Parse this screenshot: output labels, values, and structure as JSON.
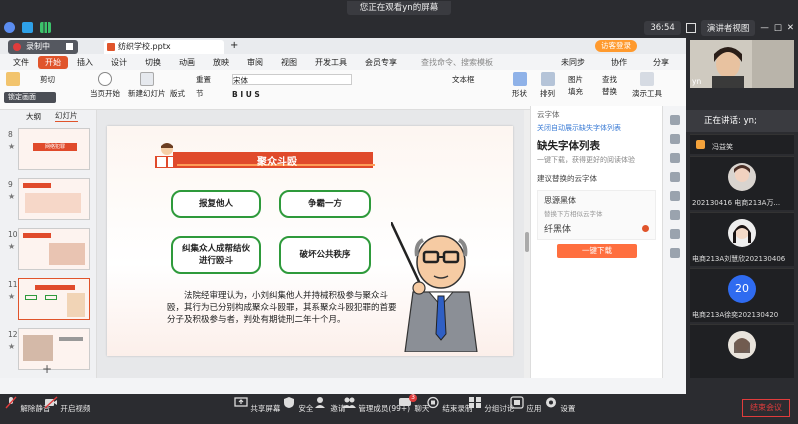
{
  "meeting": {
    "viewing_title": "您正在观看yn的屏幕",
    "time": "36:54",
    "view_mode": "演讲者视图",
    "recording_label": "录制中",
    "lock_screen": "锁定画面"
  },
  "wps": {
    "doc_tab": "纺织学校.pptx",
    "login_btn": "访客登录",
    "menu": [
      "文件",
      "开始",
      "插入",
      "设计",
      "切换",
      "动画",
      "放映",
      "审阅",
      "视图",
      "开发工具",
      "会员专享"
    ],
    "search": "查找命令、搜索模板",
    "menu_right": [
      "未同步",
      "协作",
      "分享"
    ],
    "ribbon": {
      "paste": "粘贴",
      "copy": "复制",
      "format": "格式刷",
      "cut": "剪切",
      "from_current": "当页开始",
      "new_slide": "新建幻灯片",
      "layout": "版式",
      "section": "节",
      "reset": "重置",
      "text_box": "文本框",
      "shape": "形状",
      "arrange": "排列",
      "picture": "图片",
      "fill": "填充",
      "find": "查找",
      "replace": "替换",
      "select": "选择",
      "textbox2": "文本框",
      "toolbox": "演示工具",
      "fonts": "宋体"
    },
    "thumb_tabs": [
      "大纲",
      "幻灯片"
    ],
    "slides": [
      {
        "num": "8",
        "caption": "网络犯罪"
      },
      {
        "num": "9",
        "caption": ""
      },
      {
        "num": "10",
        "caption": ""
      },
      {
        "num": "11",
        "caption": ""
      },
      {
        "num": "12",
        "caption": ""
      }
    ],
    "star": "★"
  },
  "slide": {
    "title": "聚众斗殴",
    "boxes": [
      "报复他人",
      "争霸一方",
      "纠集众人成帮结伙进行殴斗",
      "破坏公共秩序"
    ],
    "body": "法院经审理认为，小刘纠集他人并持械积极参与聚众斗殴，其行为已分别构成聚众斗殴罪，其系聚众斗殴犯罪的首要分子及积极参与者，判处有期徒刑二年十个月。"
  },
  "panel": {
    "top_label": "云字体",
    "link": "关闭自动展示缺失字体列表",
    "heading": "缺失字体列表",
    "sub": "一键下载，获得更好的阅读体验",
    "section": "建议替换的云字体",
    "card_font": "思源黑体",
    "card_hint": "替换下方相似云字体",
    "card_font2": "纤黑体",
    "download_btn": "一键下载"
  },
  "gallery": {
    "cam_name": "yn",
    "speaking_label": "正在讲话: yn;",
    "participants": [
      {
        "name": "冯益笑",
        "number": ""
      },
      {
        "name": "202130416 电商213A万...",
        "number": ""
      },
      {
        "name": "电商213A刘慧欣202130406",
        "number": ""
      },
      {
        "name": "电商213A徐奕202130420",
        "number": "20"
      },
      {
        "name": "",
        "number": ""
      }
    ]
  },
  "toolbar": {
    "mute": "解除静音",
    "video": "开启视频",
    "share": "共享屏幕",
    "security": "安全",
    "invite": "邀请",
    "members": "管理成员(99+)",
    "chat": "聊天",
    "chat_badge": "3",
    "record": "结束录制",
    "breakout": "分组讨论",
    "apps": "应用",
    "settings": "设置",
    "end": "结束会议"
  }
}
